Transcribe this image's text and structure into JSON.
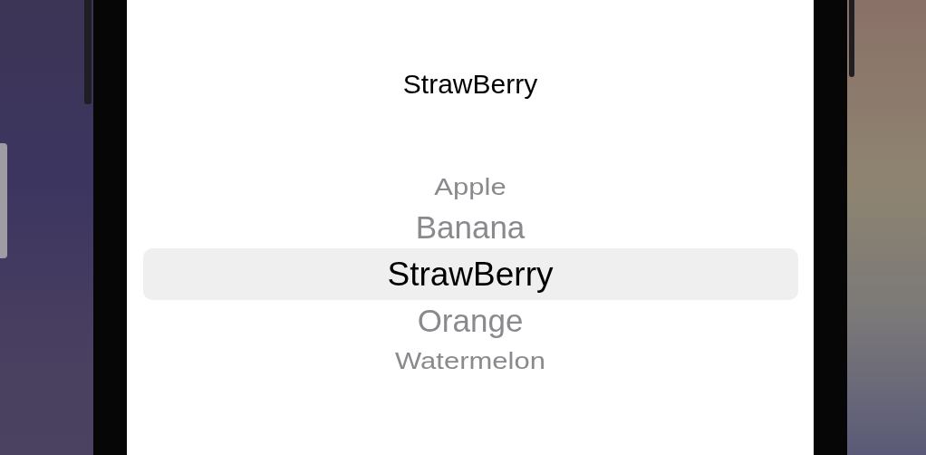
{
  "title": "StrawBerry",
  "picker": {
    "items": [
      {
        "label": "Apple",
        "selected": false
      },
      {
        "label": "Banana",
        "selected": false
      },
      {
        "label": "StrawBerry",
        "selected": true
      },
      {
        "label": "Orange",
        "selected": false
      },
      {
        "label": "Watermelon",
        "selected": false
      }
    ]
  }
}
